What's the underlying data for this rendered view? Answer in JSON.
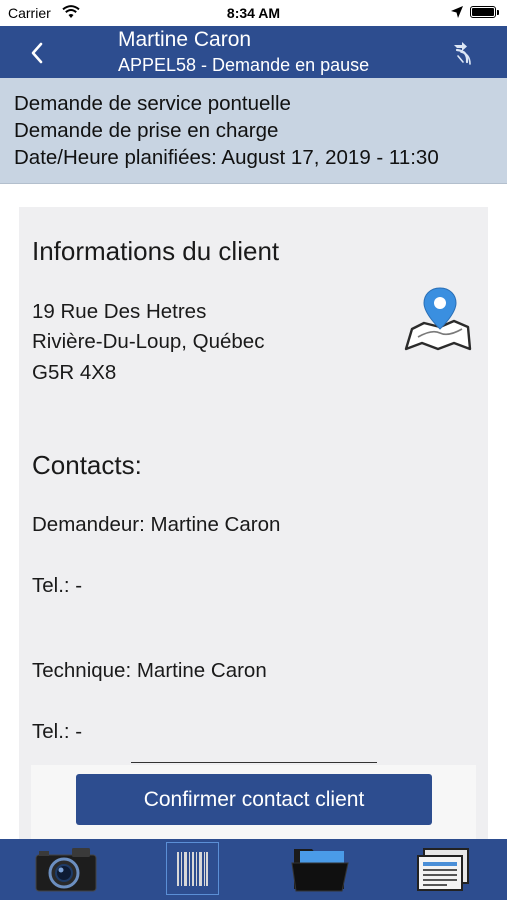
{
  "status_bar": {
    "carrier": "Carrier",
    "time": "8:34 AM",
    "icons": [
      "wifi-icon",
      "location-arrow-icon",
      "battery-icon"
    ]
  },
  "nav": {
    "title": "Martine Caron",
    "subtitle": "APPEL58 - Demande en pause",
    "back_icon": "chevron-left-icon",
    "action_icon": "route-arrow-icon"
  },
  "info": {
    "line1": "Demande de service pontuelle",
    "line2": "Demande de prise en charge",
    "line3": "Date/Heure planifiées: August 17, 2019 - 11:30"
  },
  "client": {
    "heading": "Informations du client",
    "address_line1": "19 Rue Des Hetres",
    "address_line2": "Rivière-Du-Loup, Québec",
    "postal_code": "G5R 4X8",
    "map_icon": "map-pin-icon"
  },
  "contacts": {
    "heading": "Contacts:",
    "requester": "Demandeur: Martine Caron",
    "requester_tel": "Tel.: -",
    "technical": "Technique: Martine Caron",
    "technical_tel": "Tel.: -"
  },
  "actions": {
    "confirm_label": "Confirmer contact client"
  },
  "tab_bar": {
    "tabs": [
      {
        "icon": "camera-icon",
        "selected": false
      },
      {
        "icon": "barcode-icon",
        "selected": true
      },
      {
        "icon": "folder-icon",
        "selected": false
      },
      {
        "icon": "documents-icon",
        "selected": false
      }
    ]
  },
  "colors": {
    "primary": "#2d4d8f",
    "info_band": "#c8d4e2",
    "card": "#efeff1",
    "map_pin": "#3a8fe0"
  }
}
